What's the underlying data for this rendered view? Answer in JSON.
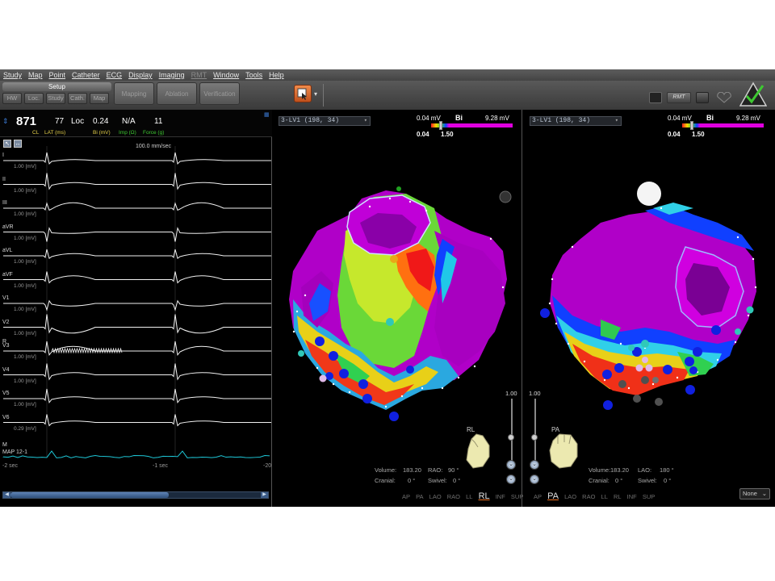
{
  "menu": [
    "Study",
    "Map",
    "Point",
    "Catheter",
    "ECG",
    "Display",
    "Imaging",
    "RMT",
    "Window",
    "Tools",
    "Help"
  ],
  "toolbar": {
    "setup_label": "Setup",
    "setup_subtabs": [
      "HW",
      "Loc.",
      "Study",
      "Cath.",
      "Map"
    ],
    "phase_tabs": [
      "Mapping",
      "Ablation",
      "Verification"
    ],
    "rmt_label": "RMT"
  },
  "stats": {
    "cl_value": "871",
    "cl_label": "CL",
    "lat_value": "77",
    "lat_label": "LAT (ms)",
    "loc_value": "Loc",
    "bi_value": "0.24",
    "bi_label": "Bi (mV)",
    "imp_value": "N/A",
    "imp_label": "Imp (Ω)",
    "force_value": "11",
    "force_label": "Force (g)"
  },
  "ecg": {
    "speed": "100.0 mm/sec",
    "unit_label": "[mV]",
    "leads": [
      {
        "name": "I",
        "scale": "1.00"
      },
      {
        "name": "II",
        "scale": "1.00"
      },
      {
        "name": "III",
        "scale": "1.00"
      },
      {
        "name": "aVR",
        "scale": "1.00"
      },
      {
        "name": "aVL",
        "scale": "1.00"
      },
      {
        "name": "aVF",
        "scale": "1.00"
      },
      {
        "name": "V1",
        "scale": "1.00"
      },
      {
        "name": "V2",
        "scale": "1.00"
      },
      {
        "name": "V3",
        "scale": "1.00"
      },
      {
        "name": "V4",
        "scale": "1.00"
      },
      {
        "name": "V5",
        "scale": "1.00"
      },
      {
        "name": "V6",
        "scale": "0.29"
      }
    ],
    "map_label": "MAP 12-1",
    "m_label": "M",
    "r_label": "R",
    "time_left": "-2 sec",
    "time_mid": "-1 sec",
    "time_right": "-20"
  },
  "maps": [
    {
      "map_name": "3-LV1 (198, 34)",
      "cb_min": "0.04 mV",
      "cb_mode": "Bi",
      "cb_max": "9.28 mV",
      "cb_lo": "0.04",
      "cb_hi": "1.50",
      "volume_label": "Volume:",
      "volume_value": "183.20",
      "angle_label": "RAO:",
      "angle_value": "90 °",
      "cranial_label": "Cranial:",
      "cranial_value": "0 °",
      "swivel_label": "Swivel:",
      "swivel_value": "0 °",
      "zoom": "1.00",
      "orientation": "RL",
      "views": [
        "AP",
        "PA",
        "LAO",
        "RAO",
        "LL",
        "RL",
        "INF",
        "SUP"
      ],
      "active_view": "RL"
    },
    {
      "map_name": "3-LV1 (198, 34)",
      "cb_min": "0.04 mV",
      "cb_mode": "Bi",
      "cb_max": "9.28 mV",
      "cb_lo": "0.04",
      "cb_hi": "1.50",
      "volume_label": "Volume:",
      "volume_value": "183.20",
      "angle_label": "LAO:",
      "angle_value": "180 °",
      "cranial_label": "Cranial:",
      "cranial_value": "0 °",
      "swivel_label": "Swivel:",
      "swivel_value": "0 °",
      "zoom": "1.00",
      "orientation": "PA",
      "views": [
        "AP",
        "PA",
        "LAO",
        "RAO",
        "LL",
        "RL",
        "INF",
        "SUP"
      ],
      "active_view": "PA",
      "none_select": "None"
    }
  ]
}
